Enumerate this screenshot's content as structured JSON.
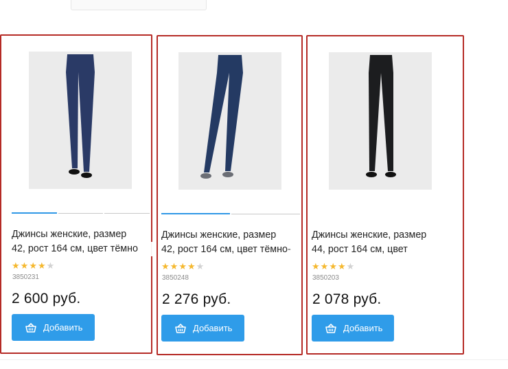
{
  "products": [
    {
      "title_line1": "Джинсы женские, размер",
      "title_line2": "42, рост 164 см, цвет тёмно",
      "rating": 4,
      "rating_max": 5,
      "sku": "3850231",
      "price": "2 600 руб.",
      "add_label": "Добавить",
      "jeans_color": "#2a3a66",
      "shoe_color": "#111111"
    },
    {
      "title_line1": "Джинсы женские, размер",
      "title_line2": "42, рост 164 см, цвет тёмно-",
      "rating": 4,
      "rating_max": 5,
      "sku": "3850248",
      "price": "2 276 руб.",
      "add_label": "Добавить",
      "jeans_color": "#243a63",
      "shoe_color": "#6b6e75"
    },
    {
      "title_line1": "Джинсы женские, размер",
      "title_line2": "44, рост 164 см, цвет",
      "rating": 4,
      "rating_max": 5,
      "sku": "3850203",
      "price": "2 078 руб.",
      "add_label": "Добавить",
      "jeans_color": "#1c1d1f",
      "shoe_color": "#111111"
    }
  ],
  "colors": {
    "accent": "#2f9ce9",
    "highlight_border": "#b52a25",
    "star_on": "#f5b82e",
    "star_off": "#d2d2d2"
  },
  "icons": {
    "add_button_icon": "basket-icon",
    "rating_icon": "star-icon"
  }
}
